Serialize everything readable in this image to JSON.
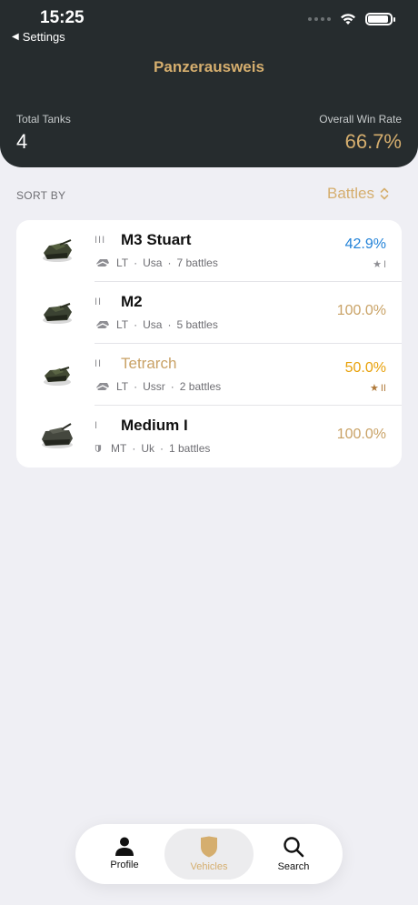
{
  "status_bar": {
    "time": "15:25",
    "back_label": "Settings"
  },
  "header": {
    "title": "Panzerausweis",
    "total_tanks_label": "Total Tanks",
    "total_tanks_value": "4",
    "win_rate_label": "Overall Win Rate",
    "win_rate_value": "66.7%"
  },
  "sort": {
    "label": "SORT BY",
    "selected": "Battles"
  },
  "colors": {
    "accent": "#d5ae6e",
    "header_bg": "#262c2e",
    "blue": "#2282d8",
    "orange": "#e8a10a"
  },
  "tanks": [
    {
      "tier": "III",
      "name": "M3 Stuart",
      "type": "LT",
      "nation": "Usa",
      "battles": "7 battles",
      "win_rate": "42.9%",
      "badge": "I",
      "type_icon": "light-tank-icon",
      "premium": false
    },
    {
      "tier": "II",
      "name": "M2",
      "type": "LT",
      "nation": "Usa",
      "battles": "5 battles",
      "win_rate": "100.0%",
      "badge": "",
      "type_icon": "light-tank-icon",
      "premium": false
    },
    {
      "tier": "II",
      "name": "Tetrarch",
      "type": "LT",
      "nation": "Ussr",
      "battles": "2 battles",
      "win_rate": "50.0%",
      "badge": "II",
      "type_icon": "light-tank-icon",
      "premium": true
    },
    {
      "tier": "I",
      "name": "Medium I",
      "type": "MT",
      "nation": "Uk",
      "battles": "1 battles",
      "win_rate": "100.0%",
      "badge": "",
      "type_icon": "medium-tank-icon",
      "premium": false
    }
  ],
  "tabs": [
    {
      "label": "Profile",
      "icon": "person-icon"
    },
    {
      "label": "Vehicles",
      "icon": "shield-icon"
    },
    {
      "label": "Search",
      "icon": "magnifier-icon"
    }
  ]
}
